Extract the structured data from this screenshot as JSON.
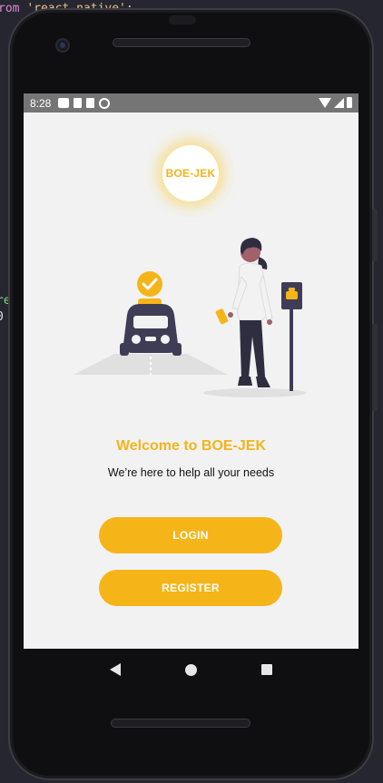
{
  "background_code": {
    "top_keyword": "rom",
    "top_string": "'react-native';",
    "line_r1": "re",
    "line_r2": "0"
  },
  "status_bar": {
    "time": "8:28",
    "left_icons": [
      "gmail-icon",
      "sd-card-icon",
      "sd-card-icon",
      "sync-icon"
    ],
    "right_icons": [
      "wifi-icon",
      "signal-icon",
      "battery-icon"
    ]
  },
  "logo": {
    "text": "BOE-JEK"
  },
  "welcome": {
    "title": "Welcome to BOE-JEK",
    "subtitle": "We’re here to help all your needs"
  },
  "buttons": {
    "login": "LOGIN",
    "register": "REGISTER"
  },
  "nav": [
    "back-icon",
    "home-icon",
    "recents-icon"
  ],
  "colors": {
    "accent": "#f5b519",
    "screen_bg": "#f2f2f2",
    "status_bar": "#757575",
    "dark_figure": "#3f3d56"
  }
}
